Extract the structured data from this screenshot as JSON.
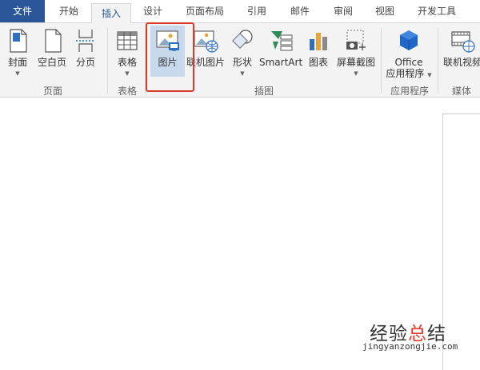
{
  "tabs": [
    {
      "id": "file",
      "label": "文件"
    },
    {
      "id": "home",
      "label": "开始"
    },
    {
      "id": "insert",
      "label": "插入"
    },
    {
      "id": "design",
      "label": "设计"
    },
    {
      "id": "layout",
      "label": "页面布局"
    },
    {
      "id": "references",
      "label": "引用"
    },
    {
      "id": "mailings",
      "label": "邮件"
    },
    {
      "id": "review",
      "label": "审阅"
    },
    {
      "id": "view",
      "label": "视图"
    },
    {
      "id": "developer",
      "label": "开发工具"
    }
  ],
  "active_tab": "插入",
  "ribbon": {
    "buttons": {
      "cover": "封面",
      "blank_page": "空白页",
      "page_break": "分页",
      "table": "表格",
      "pictures": "图片",
      "online_pictures": "联机图片",
      "shapes": "形状",
      "smartart": "SmartArt",
      "chart": "图表",
      "screenshot": "屏幕截图",
      "office_apps_1": "Office",
      "office_apps_2": "应用程序",
      "online_video": "联机视频"
    },
    "groups": {
      "pages": "页面",
      "tables": "表格",
      "illustrations": "插图",
      "apps": "应用程序",
      "media": "媒体"
    }
  },
  "watermark": {
    "title_a": "经验",
    "title_b": "总",
    "title_c": "结",
    "url": "jingyanzongjie.com"
  },
  "colors": {
    "file_tab": "#2b579a",
    "ribbon_bg": "#f3f3f3",
    "selected_button": "#c8d9ee",
    "highlight_box": "#d93a2b",
    "watermark_accent": "#e03b2c"
  }
}
